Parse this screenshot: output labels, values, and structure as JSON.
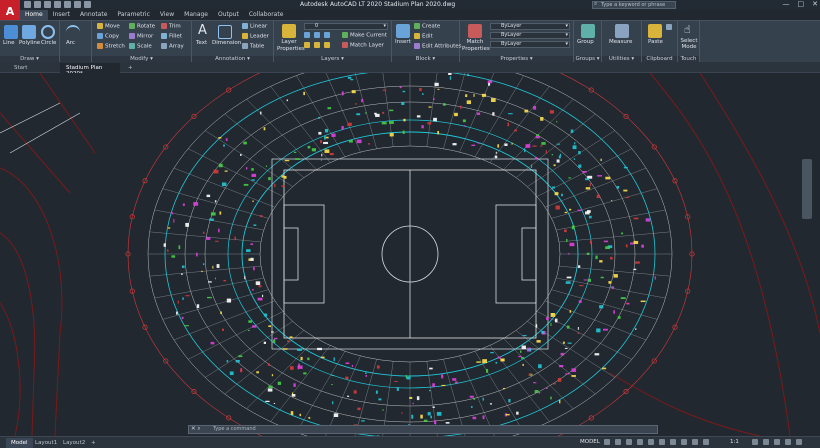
{
  "titlebar": {
    "logo": "A",
    "title": "Autodesk AutoCAD LT 2020   Stadium Plan 2020.dwg",
    "search_placeholder": "Type a keyword or phrase",
    "controls": [
      "—",
      "□",
      "✕"
    ]
  },
  "menu": {
    "tabs": [
      "Home",
      "Insert",
      "Annotate",
      "Parametric",
      "View",
      "Manage",
      "Output",
      "Collaborate"
    ]
  },
  "ribbon": {
    "draw": {
      "title": "Draw ▾",
      "tools": [
        "Line",
        "Polyline",
        "Circle",
        "Arc"
      ]
    },
    "modify": {
      "title": "Modify ▾",
      "tools": [
        "Move",
        "Rotate",
        "Trim",
        "Copy",
        "Mirror",
        "Fillet",
        "Stretch",
        "Scale",
        "Array"
      ]
    },
    "annotation": {
      "title": "Annotation ▾",
      "tools": [
        "Text",
        "Dimension",
        "Linear",
        "Leader",
        "Table"
      ]
    },
    "layers": {
      "title": "Layers ▾",
      "layer_props": "Layer Properties",
      "current_layer": "0",
      "tools": [
        "Make Current",
        "Match Layer"
      ]
    },
    "block": {
      "title": "Block ▾",
      "insert": "Insert",
      "tools": [
        "Create",
        "Edit",
        "Edit Attributes"
      ]
    },
    "properties": {
      "title": "Properties ▾",
      "match": "Match Properties",
      "bylayer": [
        "ByLayer",
        "ByLayer",
        "ByLayer"
      ]
    },
    "groups": {
      "title": "Groups ▾",
      "tool": "Group"
    },
    "utilities": {
      "title": "Utilities ▾",
      "tool": "Measure"
    },
    "clipboard": {
      "title": "Clipboard",
      "tool": "Paste"
    },
    "touch": {
      "title": "Touch",
      "tool": "Select Mode"
    }
  },
  "filetabs": [
    "Start",
    "Stadium Plan 2020*",
    "+"
  ],
  "command": {
    "placeholder": "Type a command"
  },
  "status": {
    "layouts": [
      "Model",
      "Layout1",
      "Layout2",
      "+"
    ],
    "model_label": "MODEL",
    "scale": "1:1"
  },
  "colors": {
    "accent": "#c8202a",
    "canvas": "#212830",
    "ribbon": "#36414e",
    "field": "#ffffff"
  }
}
